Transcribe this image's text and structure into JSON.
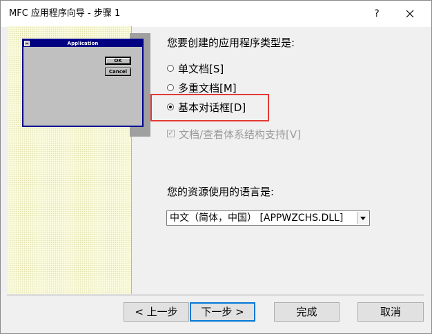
{
  "window": {
    "title": "MFC 应用程序向导 - 步骤 1",
    "help_label": "?",
    "close_icon": "close-icon"
  },
  "preview": {
    "title": "Application",
    "ok_label": "OK",
    "cancel_label": "Cancel"
  },
  "app_type": {
    "question": "您要创建的应用程序类型是:",
    "options": [
      {
        "label": "单文档[S]",
        "selected": false
      },
      {
        "label": "多重文档[M]",
        "selected": false
      },
      {
        "label": "基本对话框[D]",
        "selected": true
      }
    ]
  },
  "doc_view": {
    "label": "文档/查看体系结构支持[V]",
    "checked": true,
    "enabled": false
  },
  "language": {
    "question": "您的资源使用的语言是:",
    "selected": "中文（简体，中国） [APPWZCHS.DLL]"
  },
  "buttons": {
    "prev": "< 上一步",
    "next": "下一步 >",
    "finish": "完成",
    "cancel": "取消"
  },
  "colors": {
    "highlight": "#e53935",
    "preview_border": "#000090",
    "preview_titlebar": "#000080",
    "default_button_border": "#0078d7"
  }
}
